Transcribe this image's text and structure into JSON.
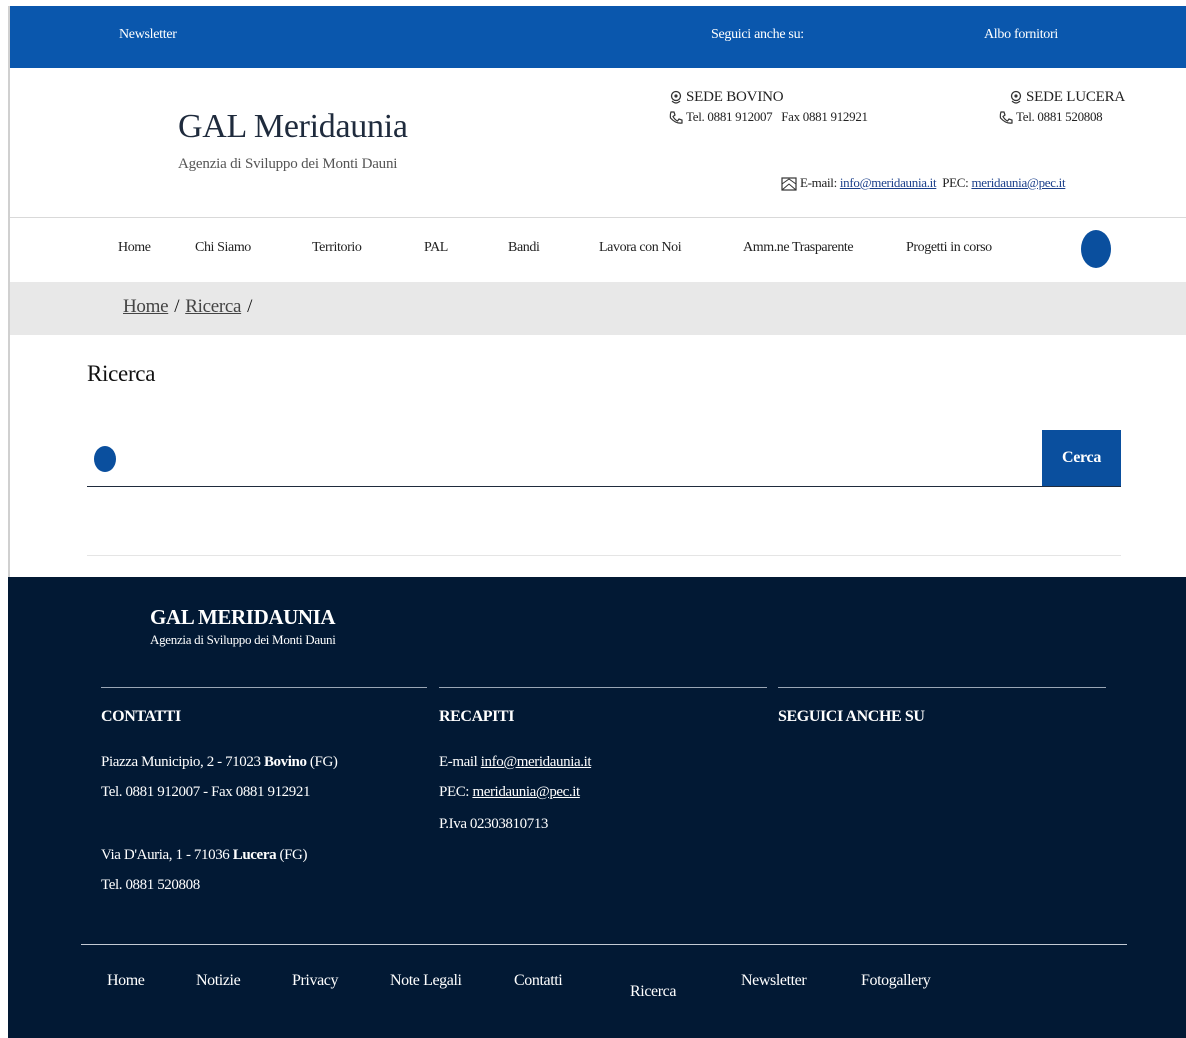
{
  "topbar": {
    "newsletter": "Newsletter",
    "follow": "Seguici anche su:",
    "suppliers": "Albo fornitori"
  },
  "brand": {
    "title": "GAL Meridaunia",
    "subtitle": "Agenzia di Sviluppo dei Monti Dauni"
  },
  "sede_bovino": {
    "title": "SEDE BOVINO",
    "phone": "Tel. 0881 912007",
    "fax": "Fax 0881 912921"
  },
  "sede_lucera": {
    "title": "SEDE LUCERA",
    "phone": "Tel. 0881 520808"
  },
  "contact": {
    "email_label": "E-mail:",
    "email": "info@meridaunia.it",
    "pec_label": "PEC:",
    "pec": "meridaunia@pec.it"
  },
  "nav": [
    "Home",
    "Chi Siamo",
    "Territorio",
    "PAL",
    "Bandi",
    "Lavora con Noi",
    "Amm.ne Trasparente",
    "Progetti in corso"
  ],
  "breadcrumb": [
    "Home",
    "Ricerca"
  ],
  "page": {
    "title": "Ricerca",
    "search_value": "",
    "search_button": "Cerca"
  },
  "footer": {
    "brand": "GAL MERIDAUNIA",
    "brand_sub": "Agenzia di Sviluppo dei Monti Dauni",
    "contatti": {
      "title": "CONTATTI",
      "addr1_pre": "Piazza Municipio, 2 - 71023 ",
      "addr1_city": "Bovino",
      "addr1_post": " (FG)",
      "tel1": "Tel. 0881 912007 - Fax 0881 912921",
      "addr2_pre": "Via D'Auria, 1 - 71036 ",
      "addr2_city": "Lucera",
      "addr2_post": " (FG)",
      "tel2": "Tel. 0881 520808"
    },
    "recapiti": {
      "title": "RECAPITI",
      "email_label": "E-mail ",
      "email": "info@meridaunia.it",
      "pec_label": "PEC: ",
      "pec": "meridaunia@pec.it",
      "piva": "P.Iva 02303810713"
    },
    "seguici": {
      "title": "SEGUICI ANCHE SU"
    },
    "links": [
      "Home",
      "Notizie",
      "Privacy",
      "Note Legali",
      "Contatti",
      "Ricerca",
      "Newsletter",
      "Fotogallery"
    ]
  },
  "colors": {
    "primary_blue": "#0a57ad",
    "footer_navy": "#021934",
    "breadcrumb_bg": "#e8e8e8"
  }
}
